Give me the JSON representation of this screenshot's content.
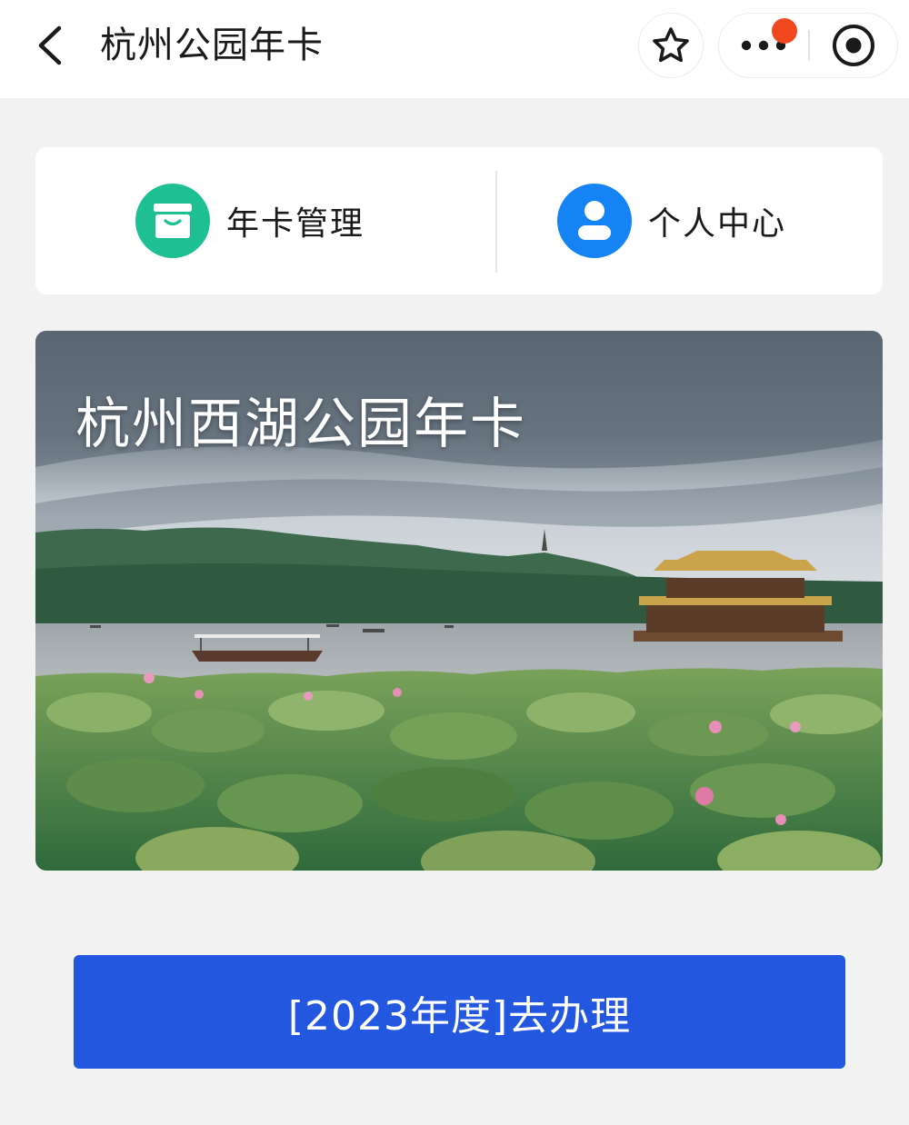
{
  "nav": {
    "title": "杭州公园年卡"
  },
  "quick_entries": [
    {
      "label": "年卡管理",
      "icon": "card-box-icon",
      "color": "#1fbf94"
    },
    {
      "label": "个人中心",
      "icon": "user-icon",
      "color": "#1683f5"
    }
  ],
  "banner": {
    "title": "杭州西湖公园年卡"
  },
  "action": {
    "label": "[2023年度]去办理",
    "color": "#2357e0"
  },
  "notification_dot_color": "#f2481f"
}
